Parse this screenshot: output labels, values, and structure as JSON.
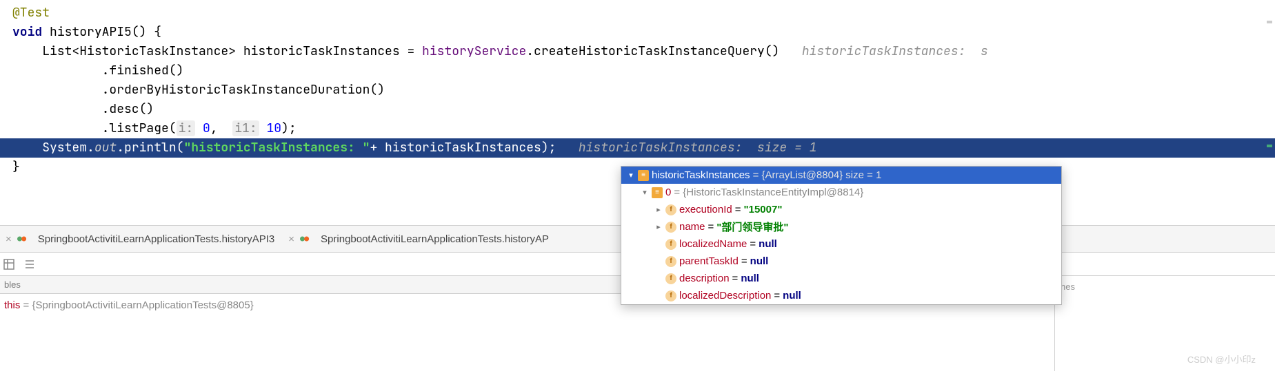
{
  "code": {
    "annotation": "@Test",
    "method_kw": "void",
    "method_name": "historyAPI5",
    "list_type": "List",
    "generic_type": "HistoricTaskInstance",
    "var_name": "historicTaskInstances",
    "equals": " = ",
    "service_field": "historyService",
    "create_query": ".createHistoricTaskInstanceQuery()",
    "inline_hint_line3": "   historicTaskInstances:  s",
    "chain_finished": ".finished()",
    "chain_orderby": ".orderByHistoricTaskInstanceDuration()",
    "chain_desc": ".desc()",
    "chain_listpage": ".listPage(",
    "param_i": "i:",
    "param_i_val": " 0",
    "comma": ",  ",
    "param_i1": "i1:",
    "param_i1_val": " 10",
    "listpage_close": ");",
    "sysout_class": "System",
    "sysout_field": "out",
    "sysout_method": ".println(",
    "sysout_str": "\"historicTaskInstances: \"",
    "sysout_plus": "+ historicTaskInstances);",
    "inline_exec": "   historicTaskInstances:  size = 1",
    "brace_close": "}"
  },
  "tabs": {
    "tab1": "SpringbootActivitiLearnApplicationTests.historyAPI3",
    "tab2": "SpringbootActivitiLearnApplicationTests.historyAP"
  },
  "vars": {
    "header": "bles",
    "this_name": "this",
    "this_val": " = {SpringbootActivitiLearnApplicationTests@8805}"
  },
  "debug": {
    "root_name": "historicTaskInstances",
    "root_val": " = {ArrayList@8804} ",
    "root_size": " size = 1",
    "idx0_name": "0",
    "idx0_val": " = {HistoricTaskInstanceEntityImpl@8814}",
    "fields": [
      {
        "name": "executionId",
        "value": "\"15007\"",
        "type": "str",
        "arrow": true
      },
      {
        "name": "name",
        "value": "\"部门领导审批\"",
        "type": "str",
        "arrow": true
      },
      {
        "name": "localizedName",
        "value": "null",
        "type": "kw",
        "arrow": false
      },
      {
        "name": "parentTaskId",
        "value": "null",
        "type": "kw",
        "arrow": false
      },
      {
        "name": "description",
        "value": "null",
        "type": "kw",
        "arrow": false
      },
      {
        "name": "localizedDescription",
        "value": "null",
        "type": "kw",
        "arrow": false
      }
    ]
  },
  "right_col": "nes",
  "watermark": "CSDN @小小印z"
}
